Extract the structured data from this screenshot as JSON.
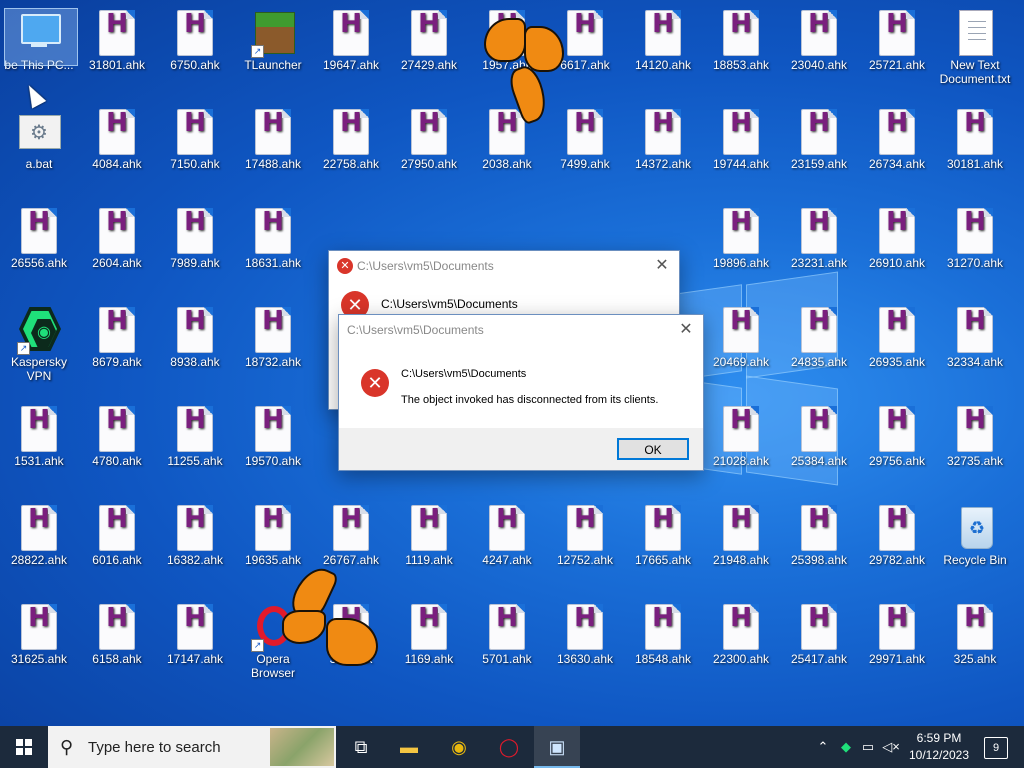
{
  "desktop": {
    "this_pc_label": "be This PC...",
    "bat_label": "a.bat",
    "tlauncher_label": "TLauncher",
    "kaspersky_label": "Kaspersky VPN",
    "opera_label": "Opera Browser",
    "new_text_label": "New Text Document.txt",
    "recycle_bin_label": "Recycle Bin",
    "col0": [
      "26556.ahk",
      "1531.ahk",
      "28822.ahk",
      "31625.ahk"
    ],
    "col1": [
      "31801.ahk",
      "4084.ahk",
      "2604.ahk",
      "8679.ahk",
      "4780.ahk",
      "6016.ahk",
      "6158.ahk"
    ],
    "col2": [
      "6750.ahk",
      "7150.ahk",
      "7989.ahk",
      "8938.ahk",
      "11255.ahk",
      "16382.ahk",
      "17147.ahk"
    ],
    "col3": [
      "17488.ahk",
      "18631.ahk",
      "18732.ahk",
      "19570.ahk",
      "19635.ahk"
    ],
    "col4": [
      "19647.ahk",
      "22758.ahk",
      "26767.ahk",
      "381.ahk"
    ],
    "col5": [
      "27429.ahk",
      "27950.ahk",
      "1119.ahk",
      "1169.ahk"
    ],
    "col6": [
      "1957.ahk",
      "2038.ahk",
      "4247.ahk",
      "5701.ahk"
    ],
    "col7": [
      "6617.ahk",
      "7499.ahk",
      "12752.ahk",
      "13630.ahk"
    ],
    "col8": [
      "14120.ahk",
      "14372.ahk",
      "17665.ahk",
      "18548.ahk"
    ],
    "col9": [
      "18853.ahk",
      "19744.ahk",
      "19896.ahk",
      "20469.ahk",
      "21028.ahk",
      "21948.ahk",
      "22300.ahk"
    ],
    "col10": [
      "23040.ahk",
      "23159.ahk",
      "23231.ahk",
      "24835.ahk",
      "25384.ahk",
      "25398.ahk",
      "25417.ahk"
    ],
    "col11": [
      "25721.ahk",
      "26734.ahk",
      "26910.ahk",
      "26935.ahk",
      "29756.ahk",
      "29782.ahk",
      "29971.ahk"
    ],
    "col12": [
      "30181.ahk",
      "31270.ahk",
      "32334.ahk",
      "32735.ahk",
      "325.ahk"
    ]
  },
  "dialog_back": {
    "title": "C:\\Users\\vm5\\Documents",
    "heading": "C:\\Users\\vm5\\Documents"
  },
  "dialog_front": {
    "title": "C:\\Users\\vm5\\Documents",
    "heading": "C:\\Users\\vm5\\Documents",
    "message": "The object invoked has disconnected from its clients.",
    "ok_label": "OK"
  },
  "taskbar": {
    "search_placeholder": "Type here to search",
    "time": "6:59 PM",
    "date": "10/12/2023",
    "notification_count": "9"
  },
  "colors": {
    "ahk_letter": "#7a1f7e",
    "error_red": "#d9352a",
    "focus_blue": "#0078d7",
    "taskbar": "#1c2a3c"
  },
  "icons": {
    "ahk": "ahk-script-icon",
    "error": "error-icon",
    "search": "search-icon",
    "start": "windows-start-icon"
  }
}
